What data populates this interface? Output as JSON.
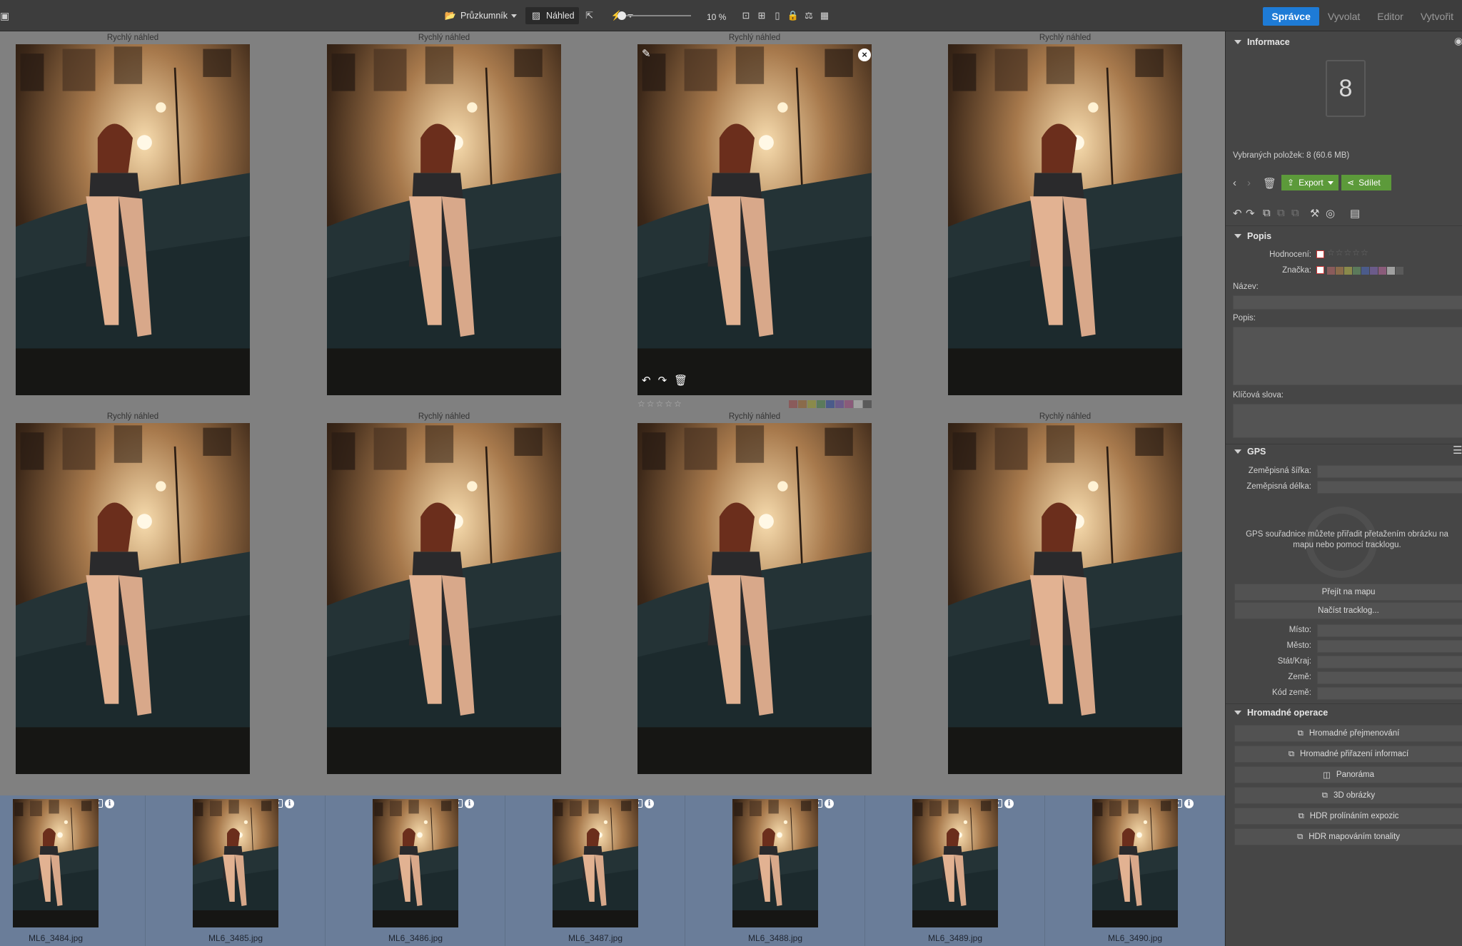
{
  "toolbar": {
    "explorer_label": "Průzkumník",
    "preview_label": "Náhled",
    "zoom": "10 %",
    "modes": [
      "Správce",
      "Vyvolat",
      "Editor",
      "Vytvořit"
    ]
  },
  "grid": {
    "quick_preview_label": "Rychlý náhled",
    "selected_index": 2,
    "rating_stars": "☆☆☆☆☆",
    "color_labels": [
      "#8a5b5b",
      "#8a6b4b",
      "#8a8a4b",
      "#5b7a5b",
      "#4b5b8a",
      "#6b5b8a",
      "#8a5b7a",
      "#a0a0a0",
      "#5a5a5a"
    ]
  },
  "filmstrip": {
    "files": [
      "ML6_3484.jpg",
      "ML6_3485.jpg",
      "ML6_3486.jpg",
      "ML6_3487.jpg",
      "ML6_3488.jpg",
      "ML6_3489.jpg",
      "ML6_3490.jpg"
    ]
  },
  "panel": {
    "info_title": "Informace",
    "count": "8",
    "selected_text": "Vybraných položek: 8 (60.6 MB)",
    "export_label": "Export",
    "share_label": "Sdílet",
    "popis_title": "Popis",
    "rating_label": "Hodnocení:",
    "tag_label": "Značka:",
    "name_label": "Název:",
    "desc_label": "Popis:",
    "keywords_label": "Klíčová slova:",
    "gps_title": "GPS",
    "lat_label": "Zeměpisná šířka:",
    "lon_label": "Zeměpisná délka:",
    "gps_hint": "GPS souřadnice můžete přiřadit přetažením obrázku na mapu nebo pomocí tracklogu.",
    "go_map": "Přejít na mapu",
    "load_tracklog": "Načíst tracklog...",
    "place_label": "Místo:",
    "city_label": "Město:",
    "state_label": "Stát/Kraj:",
    "country_label": "Země:",
    "country_code_label": "Kód země:",
    "batch_title": "Hromadné operace",
    "batch_items": [
      "Hromadné přejmenování",
      "Hromadné přiřazení informací",
      "Panoráma",
      "3D obrázky",
      "HDR prolínáním expozic",
      "HDR mapováním tonality"
    ]
  }
}
